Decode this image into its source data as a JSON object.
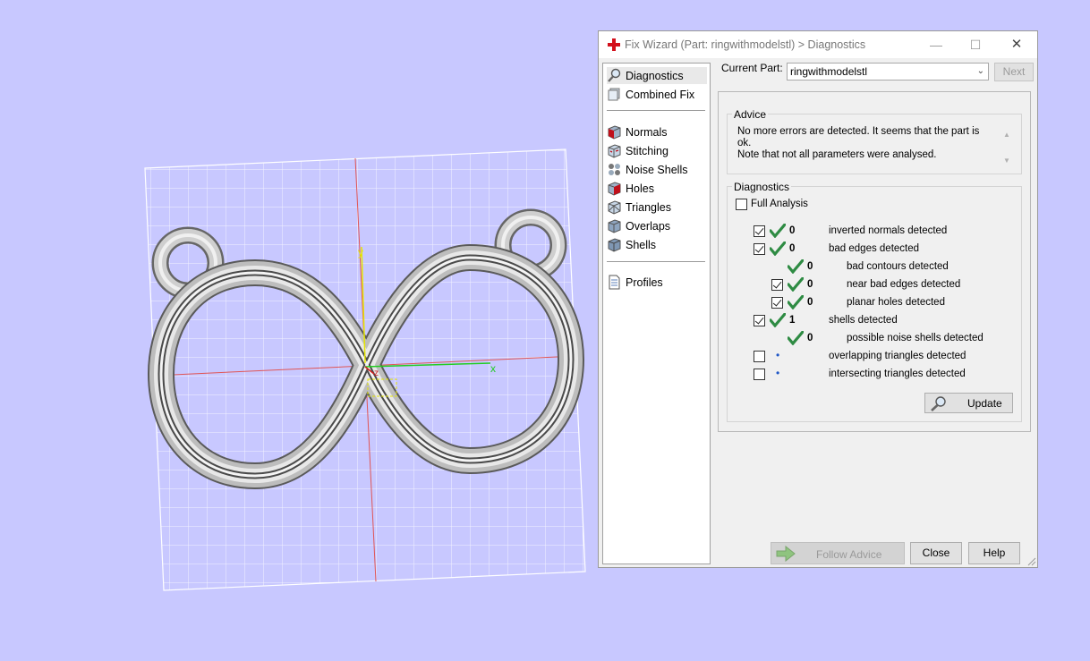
{
  "window": {
    "title": "Fix Wizard (Part: ringwithmodelstl) > Diagnostics",
    "minimize_glyph": "—",
    "maximize_glyph": "☐",
    "close_glyph": "✕"
  },
  "nav": {
    "top": [
      {
        "label": "Diagnostics",
        "icon": "magnifier-icon",
        "selected": true
      },
      {
        "label": "Combined Fix",
        "icon": "combined-fix-icon"
      }
    ],
    "tools": [
      {
        "label": "Normals",
        "icon": "normals-cube-icon"
      },
      {
        "label": "Stitching",
        "icon": "stitching-cube-icon"
      },
      {
        "label": "Noise Shells",
        "icon": "noise-shells-icon"
      },
      {
        "label": "Holes",
        "icon": "holes-cube-icon"
      },
      {
        "label": "Triangles",
        "icon": "triangles-cube-icon"
      },
      {
        "label": "Overlaps",
        "icon": "overlaps-cube-icon"
      },
      {
        "label": "Shells",
        "icon": "shells-cube-icon"
      }
    ],
    "bottom": [
      {
        "label": "Profiles",
        "icon": "document-icon"
      }
    ]
  },
  "current_part": {
    "label": "Current Part:",
    "value": "ringwithmodelstl",
    "next_label": "Next"
  },
  "advice": {
    "group_label": "Advice",
    "line1": "No more errors are detected. It seems that the part is ok.",
    "line2": "Note that not all parameters were analysed."
  },
  "diagnostics": {
    "group_label": "Diagnostics",
    "full_analysis_label": "Full Analysis",
    "rows": [
      {
        "count": "0",
        "label": "inverted normals detected"
      },
      {
        "count": "0",
        "label": "bad edges detected"
      },
      {
        "count": "0",
        "label": "bad contours detected"
      },
      {
        "count": "0",
        "label": "near bad edges detected"
      },
      {
        "count": "0",
        "label": "planar holes detected"
      },
      {
        "count": "1",
        "label": "shells detected"
      },
      {
        "count": "0",
        "label": "possible noise shells detected"
      },
      {
        "count": "•",
        "label": "overlapping triangles detected"
      },
      {
        "count": "•",
        "label": "intersecting triangles detected"
      }
    ],
    "update_label": "Update"
  },
  "footer": {
    "follow_advice_label": "Follow Advice",
    "close_label": "Close",
    "help_label": "Help"
  },
  "viewport": {
    "axis_x_label": "x",
    "axis_y_label": "y",
    "axis_z_label": "z"
  },
  "colors": {
    "background": "#c8c8ff",
    "check_green": "#2e8b43",
    "cross_red": "#d3101b",
    "axis_x": "#22cc22",
    "axis_y": "#e5e500",
    "axis_z": "#d01c1c"
  }
}
